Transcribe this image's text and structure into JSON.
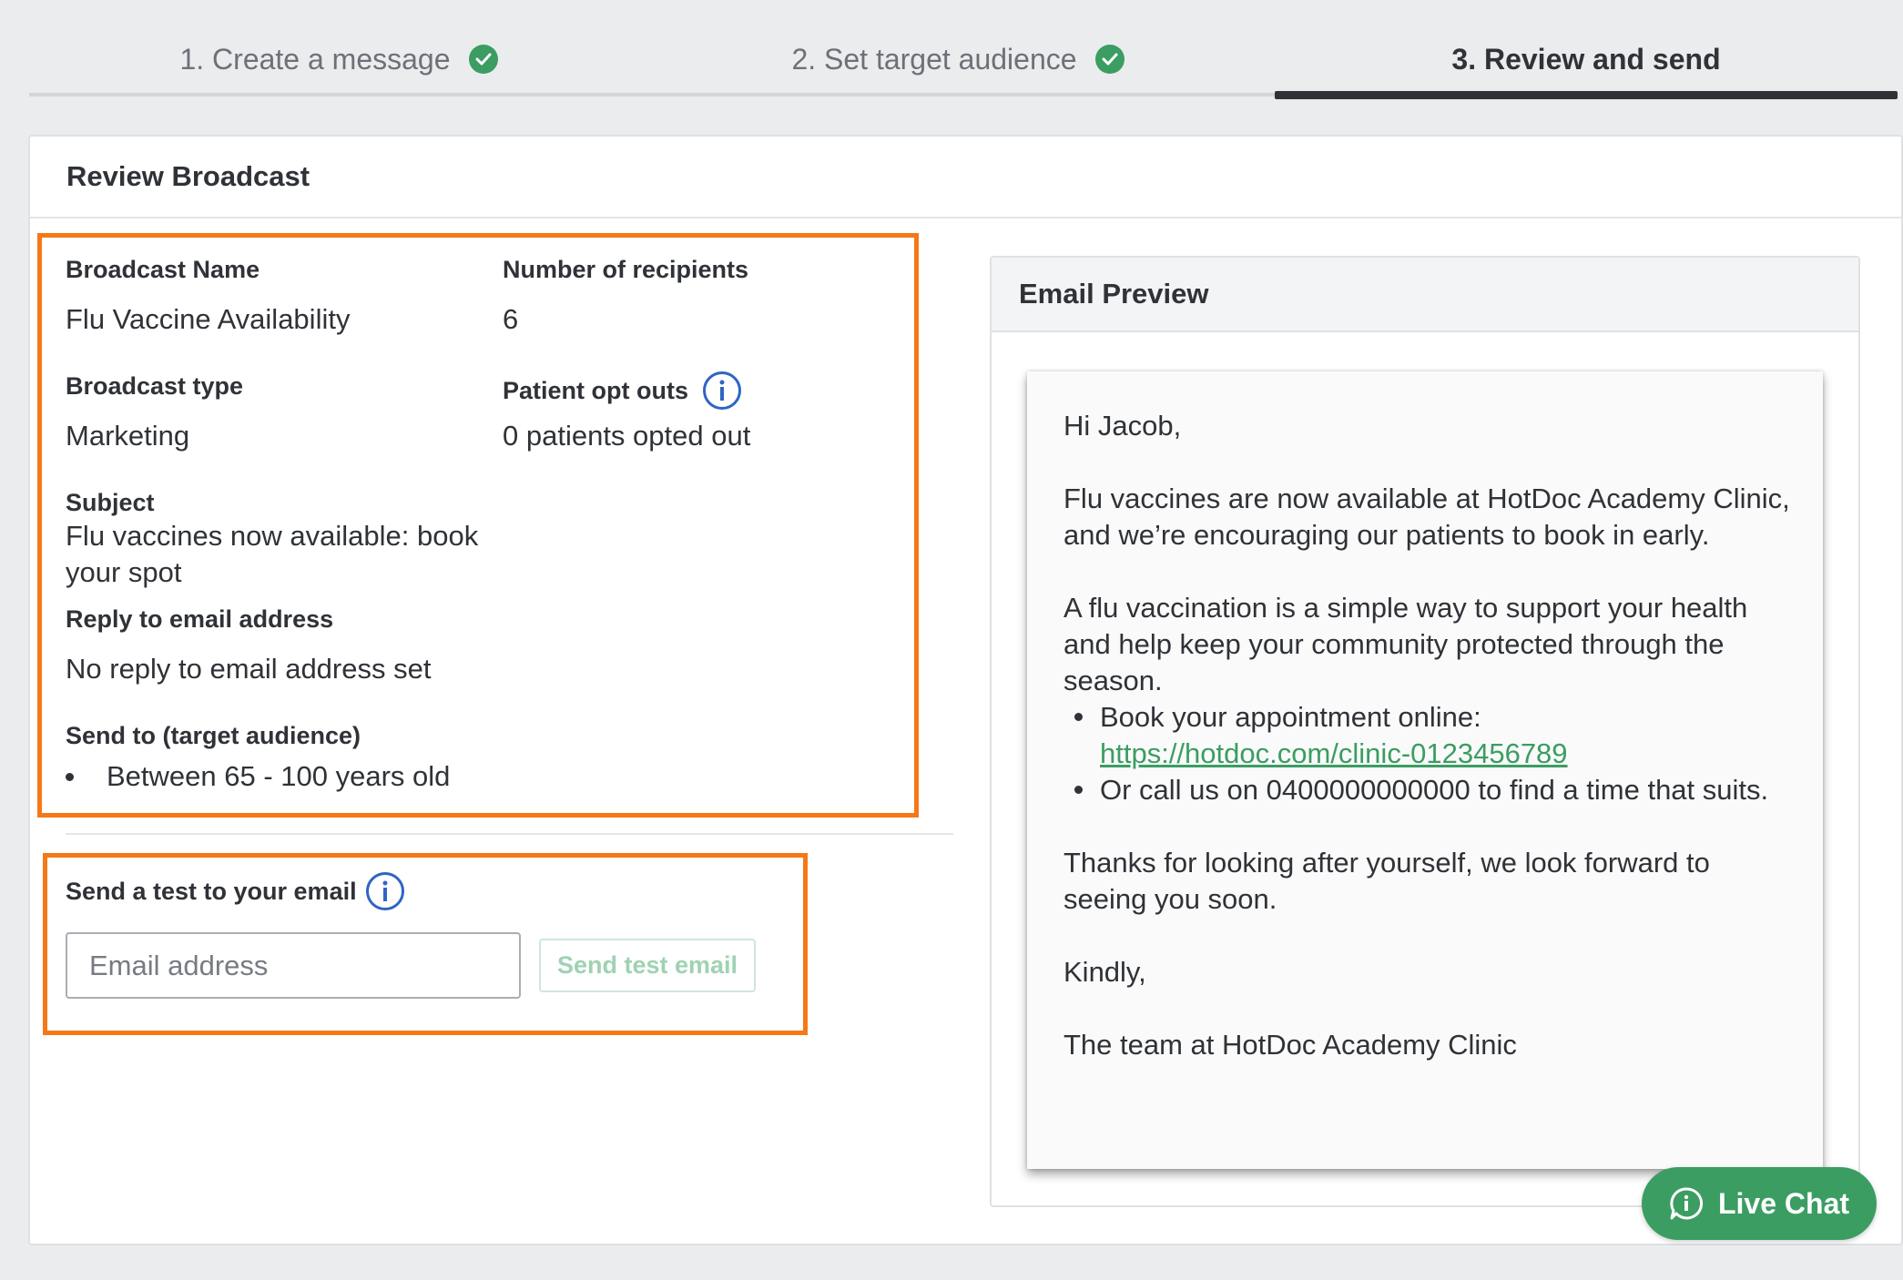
{
  "steps": [
    {
      "label": "1. Create a message",
      "done": true
    },
    {
      "label": "2. Set target audience",
      "done": true
    },
    {
      "label": "3. Review and send",
      "active": true
    }
  ],
  "card": {
    "title": "Review Broadcast"
  },
  "details": {
    "broadcast_name_label": "Broadcast Name",
    "broadcast_name_value": "Flu Vaccine Availability",
    "recipients_label": "Number of recipients",
    "recipients_value": "6",
    "broadcast_type_label": "Broadcast type",
    "broadcast_type_value": "Marketing",
    "opt_outs_label": "Patient opt outs",
    "opt_outs_value": "0 patients opted out",
    "subject_label": "Subject",
    "subject_value": "Flu vaccines now available: book your spot",
    "reply_label": "Reply to email address",
    "reply_value": "No reply to email address set",
    "send_to_label": "Send to (target audience)",
    "send_to_items": [
      "Between 65 - 100 years old"
    ]
  },
  "test_email": {
    "label": "Send a test to your email",
    "placeholder": "Email address",
    "button": "Send test email"
  },
  "preview": {
    "title": "Email Preview",
    "greeting": "Hi Jacob,",
    "para1": "Flu vaccines are now available at HotDoc Academy Clinic, and we’re encouraging our patients to book in early.",
    "para2": "A flu vaccination is a simple way to support your health and help keep your community protected through the season.",
    "bullet1_text": "Book your appointment online:",
    "bullet1_link": "https://hotdoc.com/clinic-0123456789",
    "bullet2_text": "Or call us on 0400000000000 to find a time that suits.",
    "para3": "Thanks for looking after yourself, we look forward to seeing you soon.",
    "signoff": "Kindly,",
    "signature": "The team at HotDoc Academy Clinic"
  },
  "live_chat": {
    "label": "Live Chat"
  },
  "colors": {
    "accent": "#3b9d62",
    "highlight": "#f57818",
    "info": "#2f65c4"
  }
}
